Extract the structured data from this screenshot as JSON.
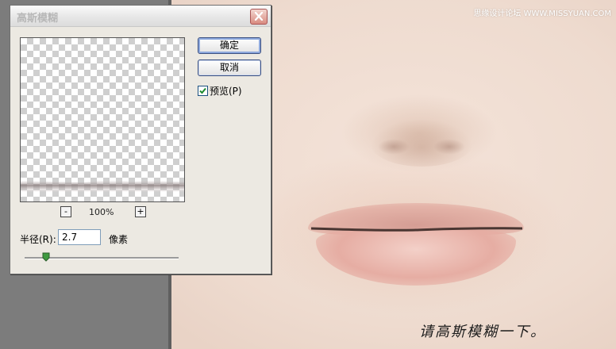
{
  "dialog": {
    "title": "高斯模糊",
    "ok_label": "确定",
    "cancel_label": "取消",
    "preview_label": "预览(P)",
    "preview_checked": true,
    "zoom": {
      "minus": "-",
      "plus": "+",
      "value": "100%"
    },
    "radius": {
      "label": "半径(R):",
      "value": "2.7",
      "unit": "像素",
      "slider_fraction": 0.14
    }
  },
  "canvas": {
    "caption": "请高斯模糊一下。"
  },
  "watermark": {
    "text": "思缘设计论坛 WWW.MISSYUAN.COM"
  },
  "colors": {
    "dialog_bg": "#ece9e2",
    "button_border": "#3a4f80",
    "check_color": "#1c8a2e",
    "workspace": "#7c7c7c",
    "lip_line": "#4a3632"
  },
  "icons": {
    "close": "close-icon",
    "check": "checkmark-icon",
    "slider": "slider-thumb-icon"
  }
}
